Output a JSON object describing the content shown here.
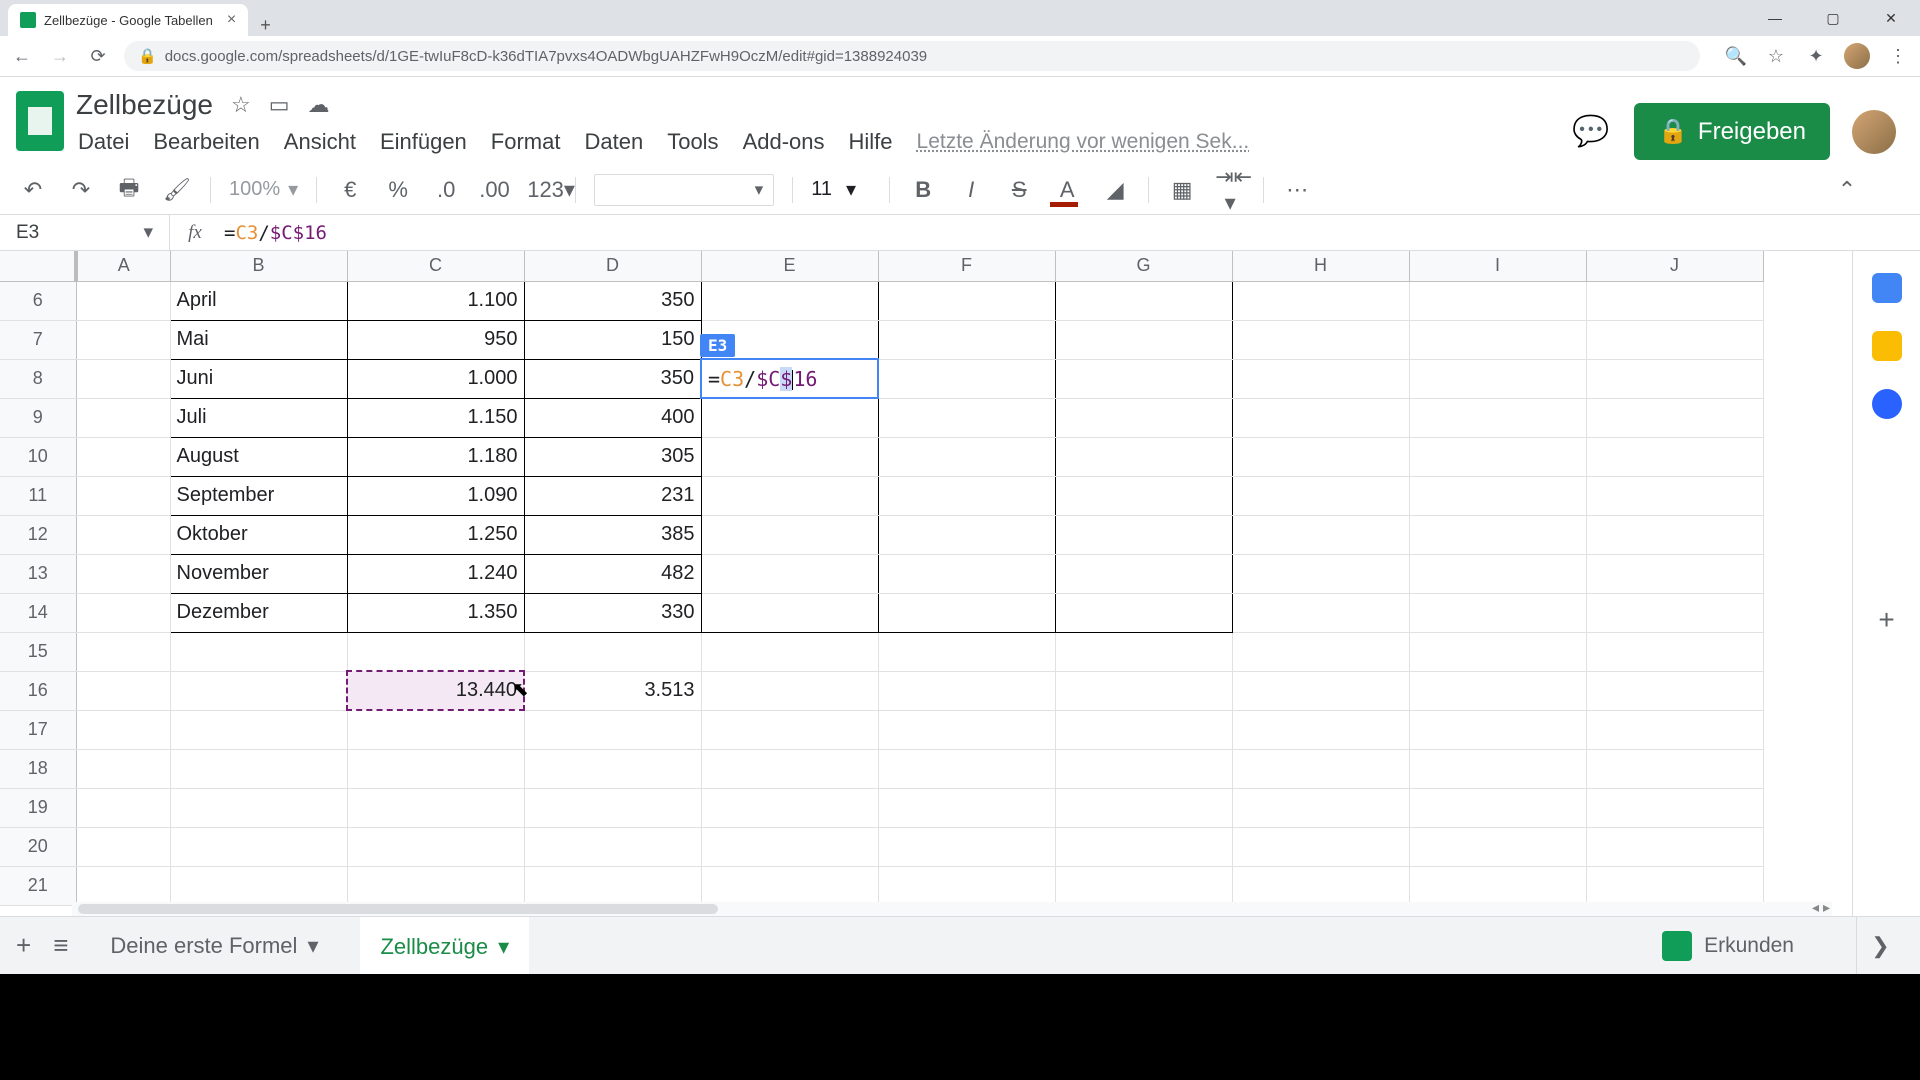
{
  "browser": {
    "tab_title": "Zellbezüge - Google Tabellen",
    "url": "docs.google.com/spreadsheets/d/1GE-twIuF8cD-k36dTIA7pvxs4OADWbgUAHZFwH9OczM/edit#gid=1388924039"
  },
  "doc": {
    "title": "Zellbezüge",
    "last_edit": "Letzte Änderung vor wenigen Sek..."
  },
  "menus": [
    "Datei",
    "Bearbeiten",
    "Ansicht",
    "Einfügen",
    "Format",
    "Daten",
    "Tools",
    "Add-ons",
    "Hilfe"
  ],
  "share_label": "Freigeben",
  "toolbar": {
    "zoom": "100%",
    "font_size": "11",
    "format_num": "123"
  },
  "name_box": "E3",
  "formula": {
    "raw": "=C3/$C$16",
    "p1": "=",
    "p2": "C3",
    "p3": "/",
    "p4": "$C$16"
  },
  "inline_edit": {
    "badge": "E3",
    "p1": "=",
    "p2": "C3",
    "p3": "/",
    "p4_a": "$C",
    "p4_b": "$",
    "p4_c": "16"
  },
  "columns": [
    "A",
    "B",
    "C",
    "D",
    "E",
    "F",
    "G",
    "H",
    "I",
    "J"
  ],
  "row_labels": [
    "6",
    "7",
    "8",
    "9",
    "10",
    "11",
    "12",
    "13",
    "14",
    "15",
    "16",
    "17",
    "18",
    "19",
    "20",
    "21"
  ],
  "rows": [
    {
      "b": "April",
      "c": "1.100",
      "d": "350"
    },
    {
      "b": "Mai",
      "c": "950",
      "d": "150"
    },
    {
      "b": "Juni",
      "c": "1.000",
      "d": "350"
    },
    {
      "b": "Juli",
      "c": "1.150",
      "d": "400"
    },
    {
      "b": "August",
      "c": "1.180",
      "d": "305"
    },
    {
      "b": "September",
      "c": "1.090",
      "d": "231"
    },
    {
      "b": "Oktober",
      "c": "1.250",
      "d": "385"
    },
    {
      "b": "November",
      "c": "1.240",
      "d": "482"
    },
    {
      "b": "Dezember",
      "c": "1.350",
      "d": "330"
    }
  ],
  "totals": {
    "c16": "13.440",
    "d16": "3.513"
  },
  "sheets": {
    "tab1": "Deine erste Formel",
    "tab2": "Zellbezüge",
    "explore": "Erkunden"
  }
}
